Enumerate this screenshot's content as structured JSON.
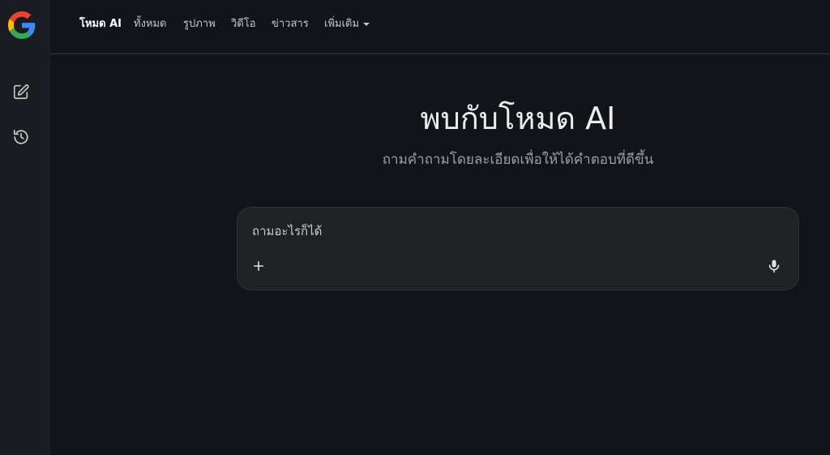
{
  "app": {
    "logo_icon": "google-g-logo",
    "colors": {
      "background": "#131419",
      "sidebar": "#1b1c21",
      "search_box": "#202125",
      "text": "#e3e3e3"
    }
  },
  "sidebar": {
    "items": [
      {
        "icon": "new-chat-edit-icon"
      },
      {
        "icon": "history-icon"
      }
    ]
  },
  "nav": {
    "tabs": [
      {
        "label": "โหมด AI",
        "active": true
      },
      {
        "label": "ทั้งหมด"
      },
      {
        "label": "รูปภาพ"
      },
      {
        "label": "วิดีโอ"
      },
      {
        "label": "ข่าวสาร"
      },
      {
        "label": "เพิ่มเติม",
        "dropdown": true
      }
    ]
  },
  "main": {
    "title": "พบกับโหมด AI",
    "subtitle": "ถามคำถามโดยละเอียดเพื่อให้ได้คำตอบที่ดีขึ้น"
  },
  "search": {
    "placeholder": "ถามอะไรก็ได้",
    "value": "",
    "add_icon": "plus-icon",
    "voice_icon": "microphone-icon"
  }
}
